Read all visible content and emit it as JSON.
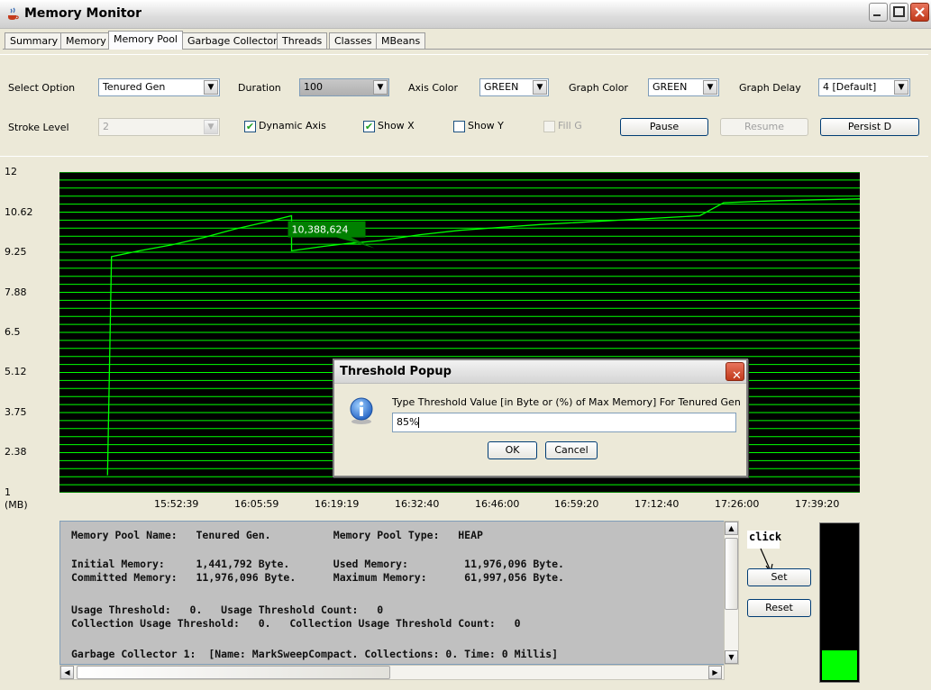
{
  "window": {
    "title": "Memory Monitor",
    "app_icon": "java-coffee-icon",
    "controls": [
      "minimize-icon",
      "maximize-icon",
      "close-icon"
    ]
  },
  "tabs": [
    "Summary",
    "Memory",
    "Memory Pool",
    "Garbage Collector",
    "Threads",
    "Classes",
    "MBeans"
  ],
  "active_tab": "Memory Pool",
  "options": {
    "select_option_label": "Select Option",
    "select_option_value": "Tenured Gen",
    "duration_label": "Duration",
    "duration_value": "100",
    "axis_color_label": "Axis Color",
    "axis_color_value": "GREEN",
    "graph_color_label": "Graph Color",
    "graph_color_value": "GREEN",
    "graph_delay_label": "Graph Delay",
    "graph_delay_value": "4 [Default]",
    "stroke_level_label": "Stroke Level",
    "stroke_level_value": "2",
    "dynamic_axis_label": "Dynamic Axis",
    "dynamic_axis_checked": true,
    "show_x_label": "Show X",
    "show_x_checked": true,
    "show_y_label": "Show Y",
    "show_y_checked": false,
    "fill_label": "Fill G",
    "fill_checked": false,
    "pause_label": "Pause",
    "resume_label": "Resume",
    "persist_label": "Persist D"
  },
  "chart_data": {
    "type": "line",
    "ylabel": "(MB)",
    "y_ticks": [
      "12",
      "10.62",
      "9.25",
      "7.88",
      "6.5",
      "5.12",
      "3.75",
      "2.38",
      "1"
    ],
    "ylim": [
      1,
      12
    ],
    "x_ticks": [
      "15:52:39",
      "16:05:59",
      "16:19:19",
      "16:32:40",
      "16:46:00",
      "16:59:20",
      "17:12:40",
      "17:26:00",
      "17:39:20"
    ],
    "grid": true,
    "background_color": "#000000",
    "grid_color": "#00ff00",
    "line_color": "#00ff00",
    "tooltip": {
      "text": "10,388,624"
    },
    "series": [
      {
        "values": [
          [
            0.06,
            1.6
          ],
          [
            0.065,
            9.1
          ],
          [
            0.1,
            9.3
          ],
          [
            0.14,
            9.5
          ],
          [
            0.18,
            9.75
          ],
          [
            0.22,
            10.05
          ],
          [
            0.26,
            10.3
          ],
          [
            0.29,
            10.5
          ],
          [
            0.29,
            9.3
          ],
          [
            0.33,
            9.45
          ],
          [
            0.36,
            9.55
          ],
          [
            0.4,
            9.65
          ],
          [
            0.45,
            9.85
          ],
          [
            0.5,
            10.0
          ],
          [
            0.55,
            10.1
          ],
          [
            0.6,
            10.2
          ],
          [
            0.7,
            10.35
          ],
          [
            0.8,
            10.5
          ],
          [
            0.83,
            10.95
          ],
          [
            0.9,
            11.02
          ],
          [
            1.0,
            11.08
          ]
        ]
      }
    ]
  },
  "info": {
    "lines": [
      "Memory Pool Name:   Tenured Gen.          Memory Pool Type:   HEAP",
      "Initial Memory:     1,441,792 Byte.       Used Memory:         11,976,096 Byte.",
      "Committed Memory:   11,976,096 Byte.      Maximum Memory:      61,997,056 Byte.",
      "Usage Threshold:   0.   Usage Threshold Count:   0",
      "Collection Usage Threshold:   0.   Collection Usage Threshold Count:   0",
      "Garbage Collector 1:  [Name: MarkSweepCompact. Collections: 0. Time: 0 Millis]"
    ]
  },
  "side": {
    "click_note": "click",
    "set_label": "Set",
    "reset_label": "Reset",
    "meter_fill": 0.19
  },
  "dialog": {
    "title": "Threshold Popup",
    "prompt": "Type Threshold Value [in Byte or (%) of Max Memory] For Tenured Gen",
    "value": "85%",
    "ok_label": "OK",
    "cancel_label": "Cancel"
  }
}
